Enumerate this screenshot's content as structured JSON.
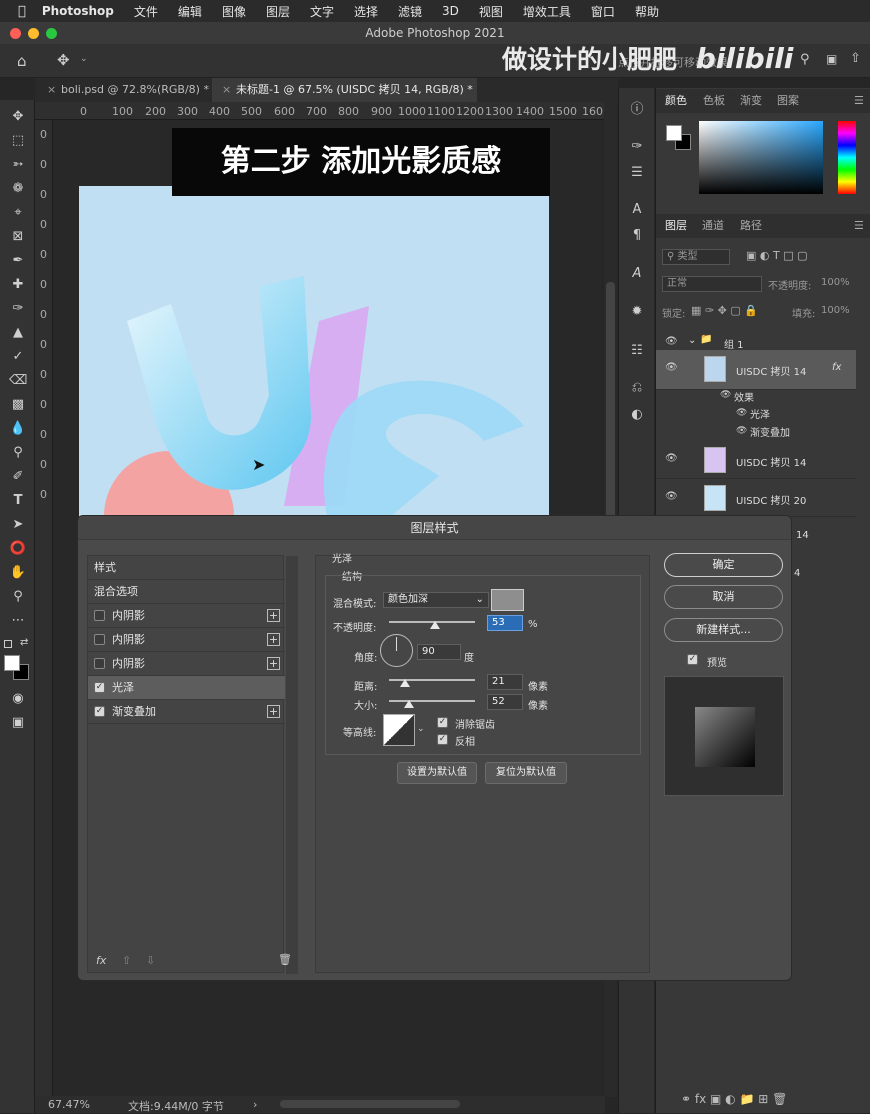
{
  "menubar": {
    "app": "Photoshop",
    "items": [
      "文件",
      "编辑",
      "图像",
      "图层",
      "文字",
      "选择",
      "滤镜",
      "3D",
      "视图",
      "增效工具",
      "窗口",
      "帮助"
    ]
  },
  "window": {
    "title": "Adobe Photoshop 2021"
  },
  "watermark": {
    "text": "做设计的小肥肥",
    "logo": "bilibili",
    "overlay_text": "点按并拖移可移动效果"
  },
  "tabs": [
    {
      "label": "boli.psd @ 72.8%(RGB/8) *"
    },
    {
      "label": "未标题-1 @ 67.5% (UISDC 拷贝 14, RGB/8) *"
    }
  ],
  "ruler": {
    "ticks": [
      "0",
      "100",
      "200",
      "300",
      "400",
      "500",
      "600",
      "700",
      "800",
      "900",
      "1000",
      "1100",
      "1200",
      "1300",
      "1400",
      "1500",
      "160"
    ]
  },
  "vruler": {
    "ticks": [
      "0",
      "0",
      "0",
      "0",
      "0",
      "0",
      "0",
      "0",
      "0",
      "0",
      "0",
      "0",
      "0"
    ]
  },
  "banner": {
    "text": "第二步 添加光影质感"
  },
  "status": {
    "zoom": "67.47%",
    "doc": "文档:9.44M/0 字节"
  },
  "color_panel": {
    "tabs": [
      "颜色",
      "色板",
      "渐变",
      "图案"
    ]
  },
  "layers_panel": {
    "tabs": [
      "图层",
      "通道",
      "路径"
    ],
    "filter": "类型",
    "blend": "正常",
    "opacity_label": "不透明度:",
    "opacity": "100%",
    "lock_label": "锁定:",
    "fill_label": "填充:",
    "fill": "100%",
    "group": "组 1",
    "selected_layer": "UISDC 拷贝 14",
    "effects_label": "效果",
    "effects": [
      "光泽",
      "渐变叠加"
    ],
    "layers": [
      "UISDC 拷贝 14",
      "UISDC 拷贝 20"
    ],
    "partial_rows": [
      "14",
      "4"
    ],
    "fx": "fx"
  },
  "dialog": {
    "title": "图层样式",
    "styles_header": "样式",
    "blend_options": "混合选项",
    "styles": [
      {
        "label": "内阴影",
        "checked": false
      },
      {
        "label": "内阴影",
        "checked": false
      },
      {
        "label": "内阴影",
        "checked": false
      },
      {
        "label": "光泽",
        "checked": true
      },
      {
        "label": "渐变叠加",
        "checked": true
      }
    ],
    "section": "光泽",
    "subsection": "结构",
    "blend_mode_label": "混合模式:",
    "blend_mode": "颜色加深",
    "opacity_label": "不透明度:",
    "opacity": "53",
    "opacity_unit": "%",
    "angle_label": "角度:",
    "angle": "90",
    "angle_unit": "度",
    "distance_label": "距离:",
    "distance": "21",
    "distance_unit": "像素",
    "size_label": "大小:",
    "size": "52",
    "size_unit": "像素",
    "contour_label": "等高线:",
    "antialias": "消除锯齿",
    "invert": "反相",
    "set_default": "设置为默认值",
    "reset_default": "复位为默认值",
    "ok": "确定",
    "cancel": "取消",
    "new_style": "新建样式...",
    "preview": "预览",
    "fx": "fx",
    "colors": {
      "gloss": "#8e8e8e"
    }
  }
}
